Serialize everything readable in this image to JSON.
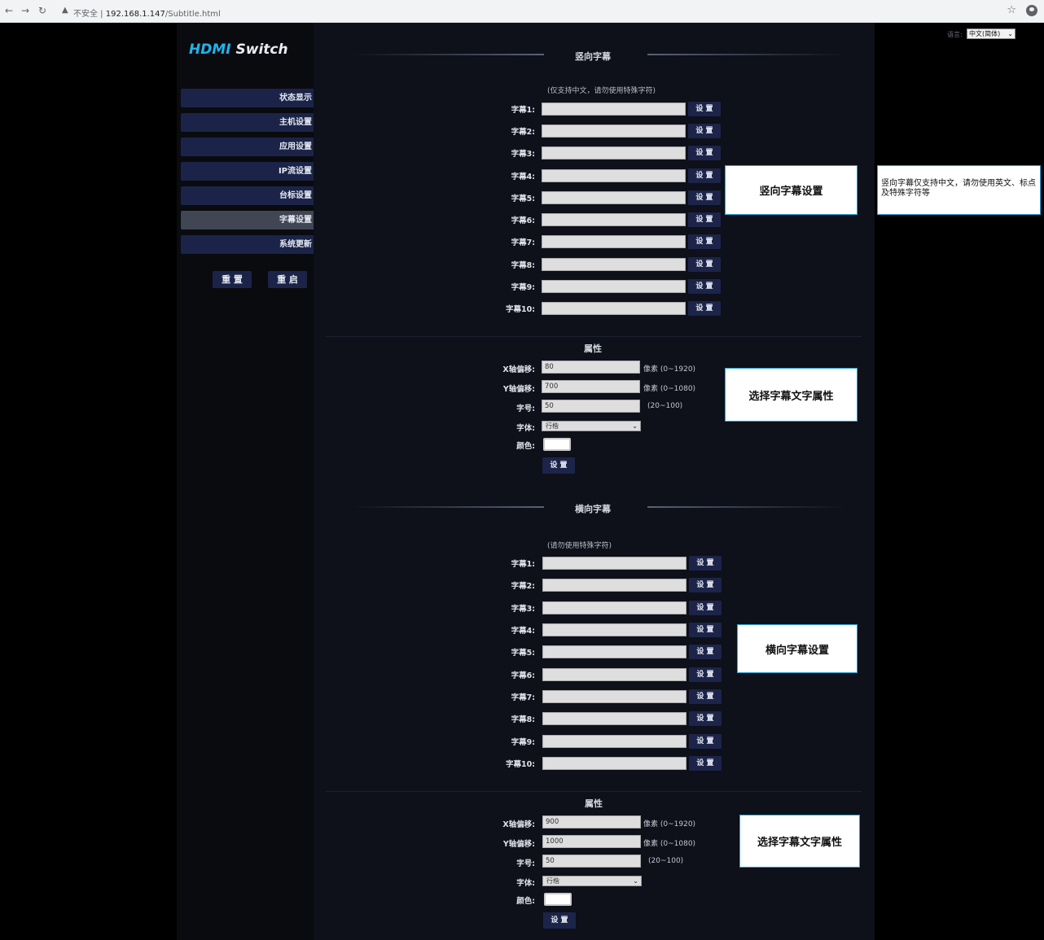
{
  "browser": {
    "insecure_label": "不安全",
    "url_host": "192.168.1.147",
    "url_path": "/Subtitle.html"
  },
  "app": {
    "logo_hdmi": "HDMI",
    "logo_switch": "Switch"
  },
  "sidebar": {
    "items": [
      {
        "label": "状态显示"
      },
      {
        "label": "主机设置"
      },
      {
        "label": "应用设置"
      },
      {
        "label": "IP流设置"
      },
      {
        "label": "台标设置"
      },
      {
        "label": "字幕设置"
      },
      {
        "label": "系统更新"
      }
    ],
    "reset_label": "重 置",
    "restart_label": "重 启"
  },
  "language": {
    "label": "语言:",
    "selected": "中文(简体)"
  },
  "vertical": {
    "title": "竖向字幕",
    "note": "(仅支持中文，请勿使用特殊字符)",
    "rows": [
      {
        "label": "字幕1:",
        "value": "",
        "btn": "设 置"
      },
      {
        "label": "字幕2:",
        "value": "",
        "btn": "设 置"
      },
      {
        "label": "字幕3:",
        "value": "",
        "btn": "设 置"
      },
      {
        "label": "字幕4:",
        "value": "",
        "btn": "设 置"
      },
      {
        "label": "字幕5:",
        "value": "",
        "btn": "设 置"
      },
      {
        "label": "字幕6:",
        "value": "",
        "btn": "设 置"
      },
      {
        "label": "字幕7:",
        "value": "",
        "btn": "设 置"
      },
      {
        "label": "字幕8:",
        "value": "",
        "btn": "设 置"
      },
      {
        "label": "字幕9:",
        "value": "",
        "btn": "设 置"
      },
      {
        "label": "字幕10:",
        "value": "",
        "btn": "设 置"
      }
    ],
    "attr": {
      "title": "属性",
      "x_label": "X轴偏移:",
      "x_value": "80",
      "x_hint": "像素 (0~1920)",
      "y_label": "Y轴偏移:",
      "y_value": "700",
      "y_hint": "像素 (0~1080)",
      "size_label": "字号:",
      "size_value": "50",
      "size_hint": "(20~100)",
      "font_label": "字体:",
      "font_value": "行楷",
      "color_label": "颜色:",
      "color_value": "#ffffff",
      "set_label": "设 置"
    }
  },
  "horizontal": {
    "title": "横向字幕",
    "note": "(请勿使用特殊字符)",
    "rows": [
      {
        "label": "字幕1:",
        "value": "",
        "btn": "设 置"
      },
      {
        "label": "字幕2:",
        "value": "",
        "btn": "设 置"
      },
      {
        "label": "字幕3:",
        "value": "",
        "btn": "设 置"
      },
      {
        "label": "字幕4:",
        "value": "",
        "btn": "设 置"
      },
      {
        "label": "字幕5:",
        "value": "",
        "btn": "设 置"
      },
      {
        "label": "字幕6:",
        "value": "",
        "btn": "设 置"
      },
      {
        "label": "字幕7:",
        "value": "",
        "btn": "设 置"
      },
      {
        "label": "字幕8:",
        "value": "",
        "btn": "设 置"
      },
      {
        "label": "字幕9:",
        "value": "",
        "btn": "设 置"
      },
      {
        "label": "字幕10:",
        "value": "",
        "btn": "设 置"
      }
    ],
    "attr": {
      "title": "属性",
      "x_label": "X轴偏移:",
      "x_value": "900",
      "x_hint": "像素 (0~1920)",
      "y_label": "Y轴偏移:",
      "y_value": "1000",
      "y_hint": "像素 (0~1080)",
      "size_label": "字号:",
      "size_value": "50",
      "size_hint": "(20~100)",
      "font_label": "字体:",
      "font_value": "行楷",
      "color_label": "颜色:",
      "color_value": "#ffffff",
      "set_label": "设 置"
    }
  },
  "callouts": {
    "vertical_settings": "竖向字幕设置",
    "vertical_note": "竖向字幕仅支持中文，请勿使用英文、标点及特殊字符等",
    "vertical_attr": "选择字幕文字属性",
    "horizontal_settings": "横向字幕设置",
    "horizontal_attr": "选择字幕文字属性"
  }
}
